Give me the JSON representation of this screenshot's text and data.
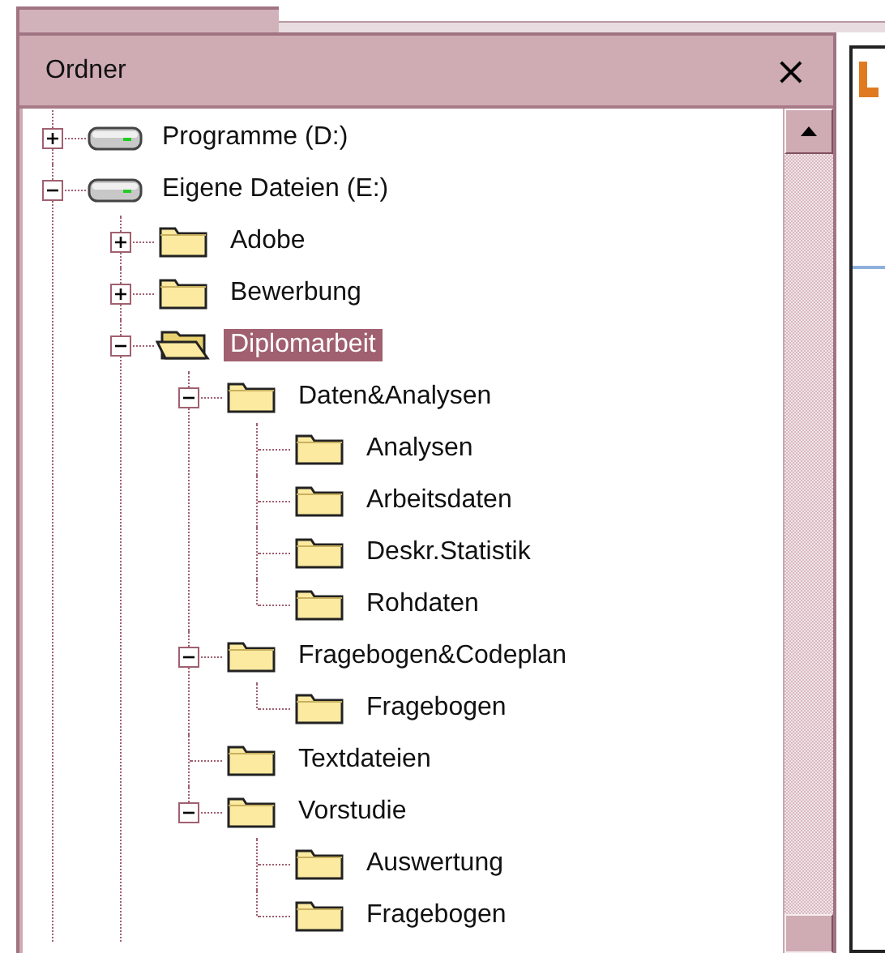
{
  "panel": {
    "title": "Ordner",
    "close": "×"
  },
  "tree": [
    {
      "label": "Programme (D:)",
      "kind": "drive",
      "expanded": false,
      "selected": false
    },
    {
      "label": "Eigene Dateien (E:)",
      "kind": "drive",
      "expanded": true,
      "selected": false,
      "children": [
        {
          "label": "Adobe",
          "kind": "folder",
          "expanded": false,
          "selected": false
        },
        {
          "label": "Bewerbung",
          "kind": "folder",
          "expanded": false,
          "selected": false
        },
        {
          "label": "Diplomarbeit",
          "kind": "folder",
          "expanded": true,
          "selected": true,
          "children": [
            {
              "label": "Daten&Analysen",
              "kind": "folder",
              "expanded": true,
              "selected": false,
              "children": [
                {
                  "label": "Analysen",
                  "kind": "folder",
                  "selected": false
                },
                {
                  "label": "Arbeitsdaten",
                  "kind": "folder",
                  "selected": false
                },
                {
                  "label": "Deskr.Statistik",
                  "kind": "folder",
                  "selected": false
                },
                {
                  "label": "Rohdaten",
                  "kind": "folder",
                  "selected": false
                }
              ]
            },
            {
              "label": "Fragebogen&Codeplan",
              "kind": "folder",
              "expanded": true,
              "selected": false,
              "children": [
                {
                  "label": "Fragebogen",
                  "kind": "folder",
                  "selected": false
                }
              ]
            },
            {
              "label": "Textdateien",
              "kind": "folder",
              "selected": false
            },
            {
              "label": "Vorstudie",
              "kind": "folder",
              "expanded": true,
              "selected": false,
              "children": [
                {
                  "label": "Auswertung",
                  "kind": "folder",
                  "selected": false
                },
                {
                  "label": "Fragebogen",
                  "kind": "folder",
                  "selected": false
                }
              ]
            }
          ]
        }
      ]
    }
  ]
}
